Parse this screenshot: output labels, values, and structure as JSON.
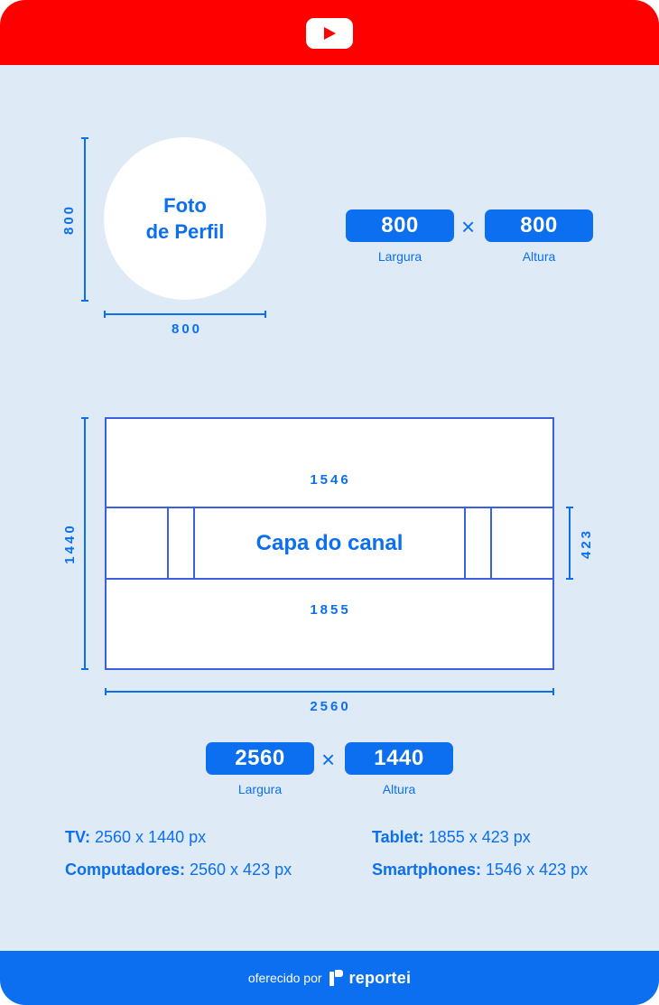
{
  "header": {
    "logo_icon": "youtube-play-icon",
    "color": "#ff0000"
  },
  "profile": {
    "circle_label": "Foto\nde Perfil",
    "height_label": "800",
    "width_label": "800",
    "width_value": "800",
    "height_value": "800",
    "width_caption": "Largura",
    "height_caption": "Altura",
    "times": "×"
  },
  "banner": {
    "title": "Capa do canal",
    "outer_height_label": "1440",
    "outer_width_label": "2560",
    "safe_width_label": "1546",
    "tablet_width_label": "1855",
    "strip_height_label": "423",
    "width_value": "2560",
    "height_value": "1440",
    "width_caption": "Largura",
    "height_caption": "Altura",
    "times": "×"
  },
  "specs": {
    "tv_label": "TV:",
    "tv_value": " 2560 x 1440 px",
    "tablet_label": "Tablet:",
    "tablet_value": " 1855 x 423 px",
    "computers_label": "Computadores:",
    "computers_value": " 2560 x 423 px",
    "smartphones_label": "Smartphones:",
    "smartphones_value": " 1546 x 423 px"
  },
  "footer": {
    "offered_by": "oferecido por",
    "brand": "reportei",
    "color": "#0b6ff0"
  },
  "colors": {
    "accent": "#0b6ff0",
    "background": "#dfeaf7",
    "line": "#3a5fe0"
  }
}
